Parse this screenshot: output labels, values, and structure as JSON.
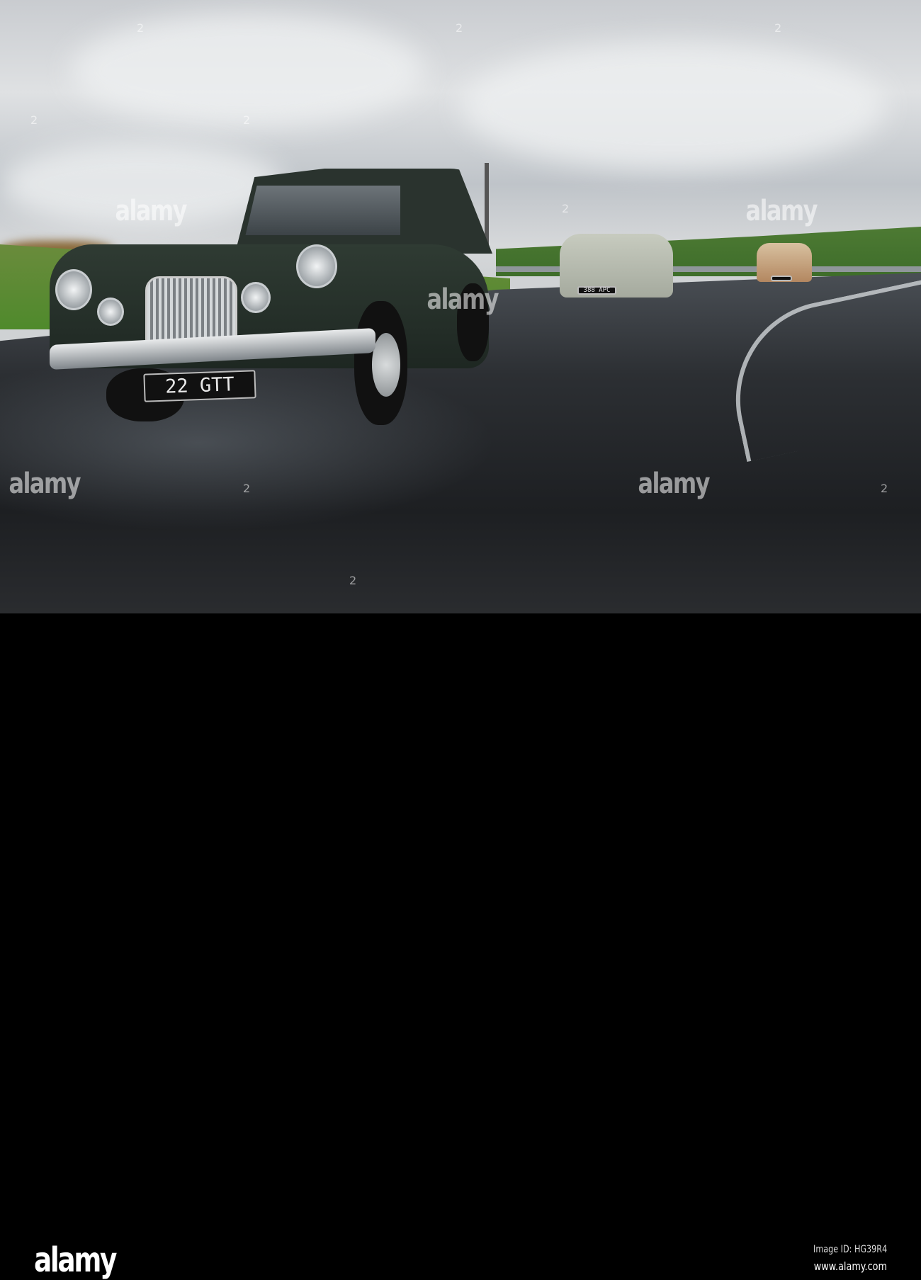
{
  "photo": {
    "subject": "Classic cars on a wet race track",
    "plates": [
      "22 GTT",
      "388 APC",
      ""
    ]
  },
  "watermark": {
    "text": "alamy",
    "numbers": [
      "2",
      "2",
      "2",
      "2",
      "2",
      "2",
      "2",
      "2",
      "2"
    ]
  },
  "footer": {
    "logo": "alamy",
    "image_id": "Image ID: HG39R4",
    "website": "www.alamy.com"
  }
}
